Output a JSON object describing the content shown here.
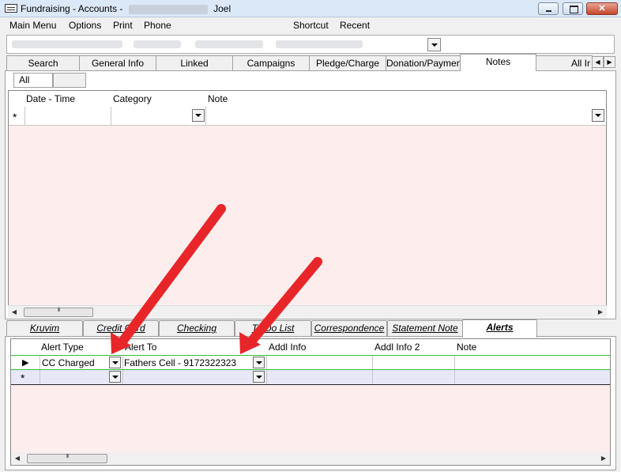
{
  "window": {
    "title_prefix": "Fundraising - Accounts -",
    "title_suffix": "Joel"
  },
  "menu": {
    "items": [
      "Main Menu",
      "Options",
      "Print",
      "Phone"
    ],
    "right_items": [
      "Shortcut",
      "Recent"
    ]
  },
  "main_tabs": [
    "Search",
    "General Info",
    "Linked",
    "Campaigns",
    "Pledge/Charge",
    "Donation/Payment",
    "Notes",
    "All Ir"
  ],
  "main_tabs_active": "Notes",
  "notes": {
    "filter_tab": "All",
    "columns": [
      "Date - Time",
      "Category",
      "Note"
    ],
    "new_row_marker": "*"
  },
  "sub_tabs": [
    "Kruvim",
    "Credit Card",
    "Checking",
    "To Do List",
    "Correspondence",
    "Statement Note",
    "Alerts"
  ],
  "sub_tabs_active": "Alerts",
  "alerts": {
    "columns": [
      "Alert Type",
      "Alert To",
      "Addl Info",
      "Addl Info 2",
      "Note"
    ],
    "rows": [
      {
        "marker": "▶",
        "alert_type": "CC Charged",
        "alert_to": "Fathers Cell - 9172322323",
        "addl_info": "",
        "addl_info_2": "",
        "note": ""
      }
    ],
    "new_row_marker": "*"
  },
  "colors": {
    "grid_background": "#fdeeed",
    "selected_row_border": "#36c036",
    "annotation_arrow": "#e8262a",
    "new_row_background": "#e7e7f8"
  },
  "icons": {
    "app": "form-icon",
    "dropdown": "chevron-down-icon",
    "scroll_left": "arrow-left-icon",
    "scroll_right": "arrow-right-icon"
  }
}
